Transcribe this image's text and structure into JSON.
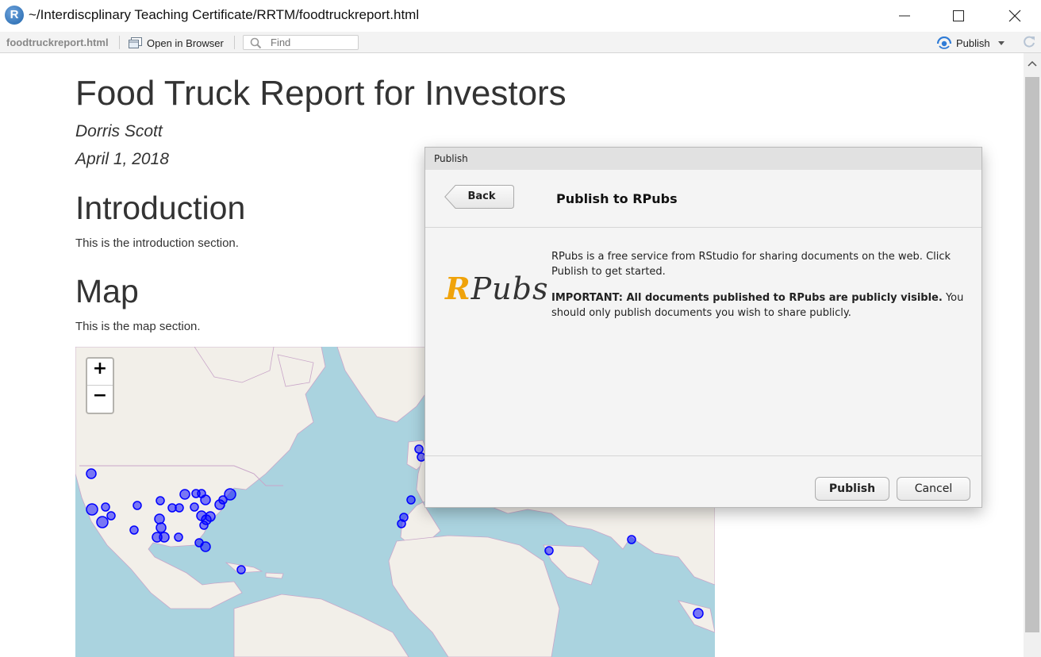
{
  "window": {
    "title": "~/Interdiscplinary Teaching Certificate/RRTM/foodtruckreport.html",
    "app_icon": "R"
  },
  "toolbar": {
    "filename": "foodtruckreport.html",
    "open_in_browser": "Open in Browser",
    "find_placeholder": "Find",
    "publish": "Publish"
  },
  "document": {
    "title": "Food Truck Report for Investors",
    "author": "Dorris Scott",
    "date": "April 1, 2018",
    "intro_heading": "Introduction",
    "intro_text": "This is the introduction section.",
    "map_heading": "Map",
    "map_text": "This is the map section."
  },
  "map": {
    "zoom_in": "+",
    "zoom_out": "−",
    "marker_color": "#0000ff"
  },
  "dialog": {
    "title": "Publish",
    "back": "Back",
    "heading": "Publish to RPubs",
    "logo_r": "R",
    "logo_rest": "Pubs",
    "description": "RPubs is a free service from RStudio for sharing documents on the web. Click Publish to get started.",
    "important_bold": "IMPORTANT: All documents published to RPubs are publicly visible.",
    "important_rest": " You should only publish documents you wish to share publicly.",
    "publish_button": "Publish",
    "cancel_button": "Cancel"
  },
  "colors": {
    "water": "#aad3df",
    "land": "#f2efe9",
    "rpubs_accent": "#f0a30a",
    "publish_icon": "#2f7bd6"
  }
}
